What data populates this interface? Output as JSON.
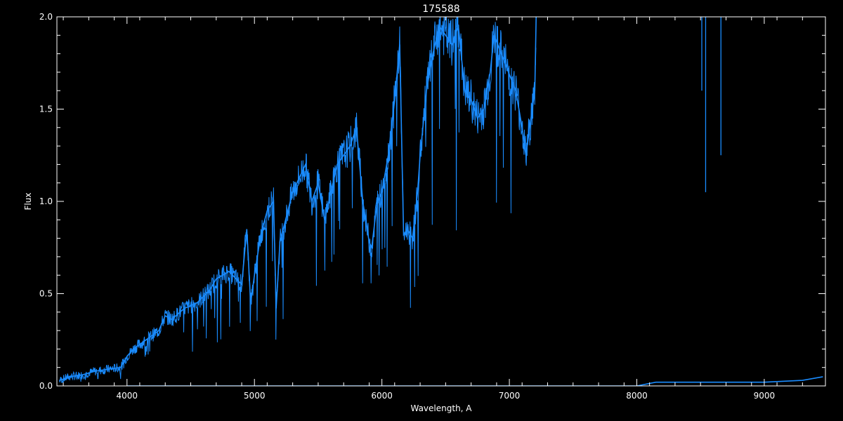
{
  "chart_data": {
    "type": "line",
    "title": "175588",
    "xlabel": "Wavelength, A",
    "ylabel": "Flux",
    "xlim": [
      3450,
      9480
    ],
    "ylim": [
      0,
      2
    ],
    "x_ticks": [
      4000,
      5000,
      6000,
      7000,
      8000,
      9000
    ],
    "x_tick_labels": [
      "4000",
      "5000",
      "6000",
      "7000",
      "8000",
      "9000"
    ],
    "y_ticks": [
      0,
      0.5,
      1.0,
      1.5,
      2.0
    ],
    "y_tick_labels": [
      "0.0",
      "0.5",
      "1.0",
      "1.5",
      "2.0"
    ],
    "grid": false,
    "colors": {
      "series": "#1a8cff",
      "axes": "#ffffff",
      "background": "#000000"
    },
    "series": [
      {
        "x": [
          3470,
          3550,
          3650,
          3750,
          3850,
          3950,
          4000,
          4050,
          4150,
          4250,
          4300,
          4350,
          4450,
          4550,
          4650,
          4700,
          4800,
          4900,
          4940,
          4970,
          5000,
          5050,
          5100,
          5150,
          5170,
          5200,
          5300,
          5400,
          5450,
          5500,
          5550,
          5600,
          5650,
          5700,
          5750,
          5800,
          5850,
          5900,
          5920,
          5960,
          6000,
          6050,
          6100,
          6140,
          6170,
          6200,
          6240,
          6280,
          6300,
          6350,
          6400,
          6450,
          6500,
          6550,
          6600,
          6650,
          6700,
          6750,
          6800,
          6850,
          6880,
          7050,
          7100,
          7130,
          7200,
          7210
        ],
        "y": [
          0.03,
          0.05,
          0.06,
          0.08,
          0.09,
          0.1,
          0.16,
          0.2,
          0.25,
          0.3,
          0.38,
          0.36,
          0.42,
          0.45,
          0.52,
          0.58,
          0.62,
          0.55,
          0.85,
          0.45,
          0.6,
          0.82,
          0.95,
          1.0,
          0.42,
          0.78,
          1.05,
          1.2,
          1.0,
          1.1,
          0.9,
          1.05,
          1.2,
          1.25,
          1.3,
          1.4,
          1.0,
          0.78,
          0.75,
          0.98,
          1.05,
          1.25,
          1.55,
          1.85,
          0.82,
          0.85,
          0.8,
          1.05,
          1.25,
          1.6,
          1.8,
          1.95,
          1.9,
          1.85,
          1.95,
          1.6,
          1.55,
          1.45,
          1.5,
          1.7,
          1.9,
          1.6,
          1.4,
          1.25,
          1.6,
          2.0
        ]
      },
      {
        "x": [
          4000,
          5000,
          6000,
          7000,
          8000,
          8150,
          8300,
          8600,
          9000,
          9300,
          9460
        ],
        "y": [
          0.0,
          0.0,
          0.0,
          0.0,
          0.0,
          0.02,
          0.02,
          0.02,
          0.02,
          0.03,
          0.05
        ]
      }
    ],
    "features": [
      {
        "x": 8540,
        "y_from": 2.0,
        "y_to": 1.05
      },
      {
        "x": 8660,
        "y_from": 2.0,
        "y_to": 1.25
      },
      {
        "x": 8510,
        "y_from": 2.0,
        "y_to": 1.6
      }
    ]
  }
}
